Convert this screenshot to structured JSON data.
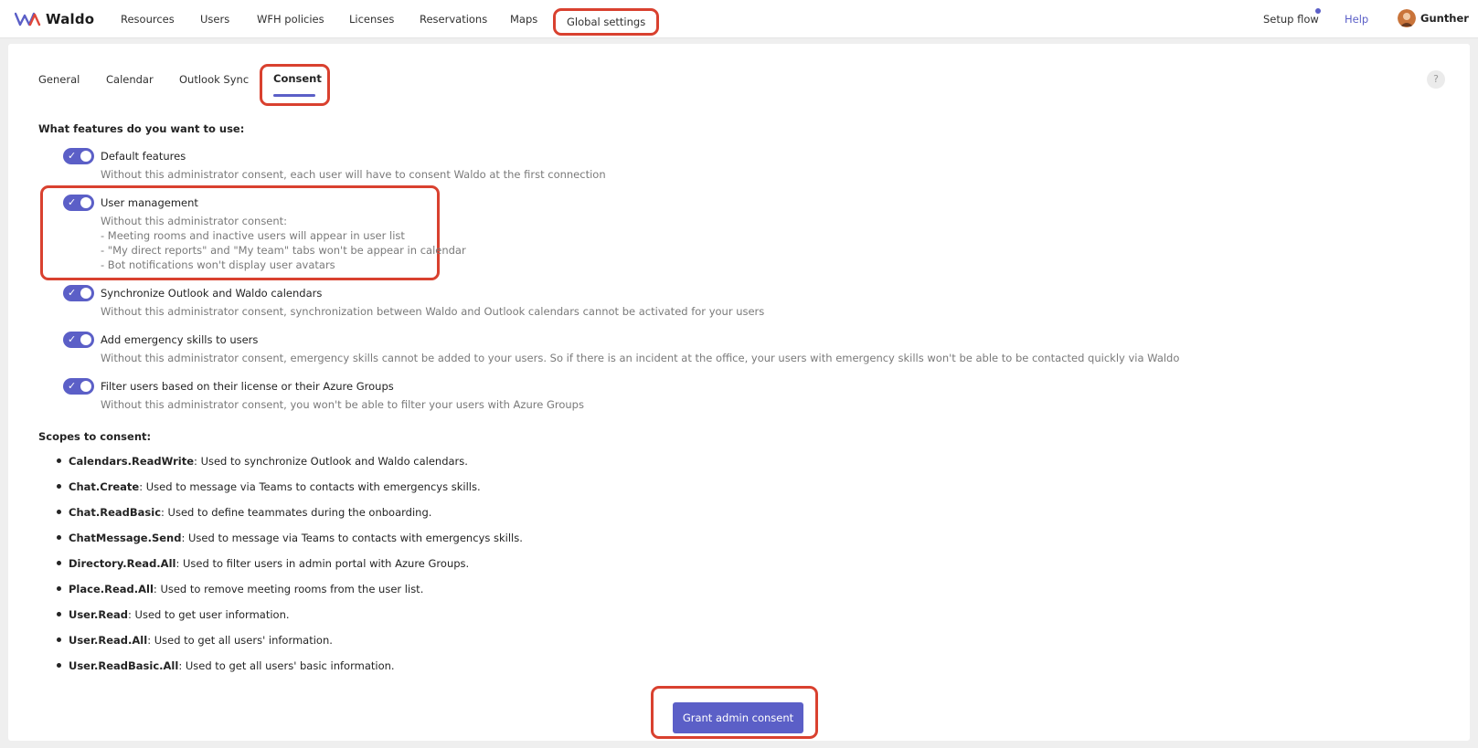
{
  "brand": {
    "name": "Waldo"
  },
  "nav": {
    "items": [
      "Resources",
      "Users",
      "WFH policies",
      "Licenses",
      "Reservations",
      "Maps",
      "Global settings"
    ],
    "setup_flow": "Setup flow",
    "help": "Help",
    "user": "Gunther"
  },
  "tabs": {
    "items": [
      "General",
      "Calendar",
      "Outlook Sync",
      "Consent"
    ],
    "active": "Consent",
    "help_icon": "?"
  },
  "features": {
    "heading": "What features do you want to use:",
    "items": [
      {
        "title": "Default features",
        "enabled": true,
        "desc": [
          "Without this administrator consent, each user will have to consent Waldo at the first connection"
        ]
      },
      {
        "title": "User management",
        "enabled": true,
        "desc": [
          "Without this administrator consent:",
          "- Meeting rooms and inactive users will appear in user list",
          "- \"My direct reports\" and \"My team\" tabs won't be appear in calendar",
          "- Bot notifications won't display user avatars"
        ]
      },
      {
        "title": "Synchronize Outlook and Waldo calendars",
        "enabled": true,
        "desc": [
          "Without this administrator consent, synchronization between Waldo and Outlook calendars cannot be activated for your users"
        ]
      },
      {
        "title": "Add emergency skills to users",
        "enabled": true,
        "desc": [
          "Without this administrator consent, emergency skills cannot be added to your users. So if there is an incident at the office, your users with emergency skills won't be able to be contacted quickly via Waldo"
        ]
      },
      {
        "title": "Filter users based on their license or their Azure Groups",
        "enabled": true,
        "desc": [
          "Without this administrator consent, you won't be able to filter your users with Azure Groups"
        ]
      }
    ]
  },
  "scopes": {
    "heading": "Scopes to consent:",
    "items": [
      {
        "name": "Calendars.ReadWrite",
        "desc": ": Used to synchronize Outlook and Waldo calendars."
      },
      {
        "name": "Chat.Create",
        "desc": ": Used to message via Teams to contacts with emergencys skills."
      },
      {
        "name": "Chat.ReadBasic",
        "desc": ": Used to define teammates during the onboarding."
      },
      {
        "name": "ChatMessage.Send",
        "desc": ": Used to message via Teams to contacts with emergencys skills."
      },
      {
        "name": "Directory.Read.All",
        "desc": ": Used to filter users in admin portal with Azure Groups."
      },
      {
        "name": "Place.Read.All",
        "desc": ": Used to remove meeting rooms from the user list."
      },
      {
        "name": "User.Read",
        "desc": ": Used to get user information."
      },
      {
        "name": "User.Read.All",
        "desc": ": Used to get all users' information."
      },
      {
        "name": "User.ReadBasic.All",
        "desc": ": Used to get all users' basic information."
      }
    ]
  },
  "actions": {
    "grant": "Grant admin consent"
  },
  "colors": {
    "accent": "#5b5fc7",
    "highlight": "#d9412f"
  }
}
